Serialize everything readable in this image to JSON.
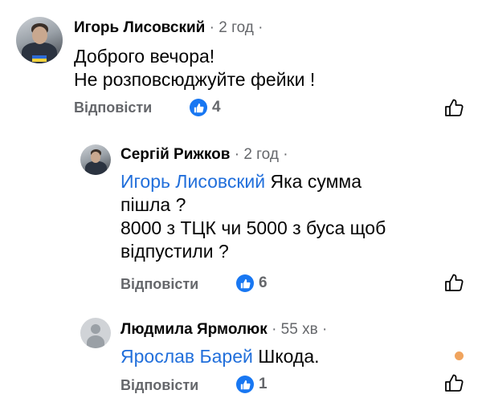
{
  "comments": [
    {
      "author": "Игорь Лисовский",
      "time": "2 год",
      "lines": [
        "Доброго вечора!",
        "Не розповсюджуйте фейки !"
      ],
      "reply_label": "Відповісти",
      "reactions": "4",
      "avatar_icon": "user-photo-icon"
    },
    {
      "author": "Сергій Рижков",
      "time": "2 год",
      "mention": "Игорь Лисовский",
      "lines": [
        "Яка сумма",
        "пішла ?",
        "8000 з ТЦК чи 5000 з буса щоб",
        "відпустили ?"
      ],
      "reply_label": "Відповісти",
      "reactions": "6",
      "avatar_icon": "user-photo-icon"
    },
    {
      "author": "Людмила Ярмолюк",
      "time": "55 хв",
      "mention": "Ярослав Барей",
      "lines": [
        "Шкода."
      ],
      "reply_label": "Відповісти",
      "reactions": "1",
      "avatar_icon": "default-avatar-icon"
    }
  ],
  "colors": {
    "mention": "#216fdb",
    "like_badge": "#1877f2",
    "secondary_text": "#65676b",
    "notification_dot": "#f0a45e"
  }
}
